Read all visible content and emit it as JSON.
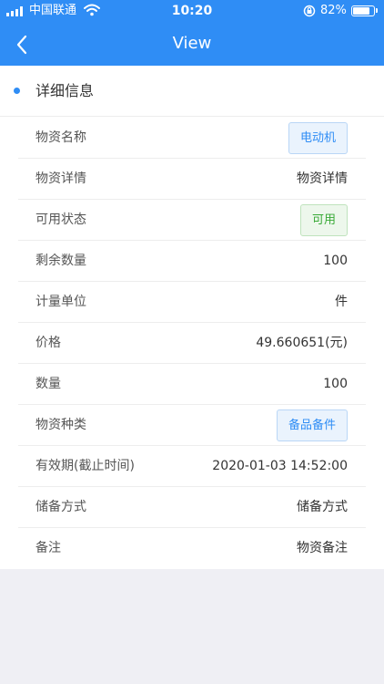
{
  "status_bar": {
    "carrier": "中国联通",
    "time": "10:20",
    "battery_text": "82%",
    "battery_level": 0.82
  },
  "nav": {
    "title": "View"
  },
  "section": {
    "title": "详细信息"
  },
  "fields": [
    {
      "label": "物资名称",
      "value": "电动机",
      "style": "tag-blue"
    },
    {
      "label": "物资详情",
      "value": "物资详情",
      "style": "text"
    },
    {
      "label": "可用状态",
      "value": "可用",
      "style": "tag-green"
    },
    {
      "label": "剩余数量",
      "value": "100",
      "style": "text"
    },
    {
      "label": "计量单位",
      "value": "件",
      "style": "text"
    },
    {
      "label": "价格",
      "value": "49.660651(元)",
      "style": "text"
    },
    {
      "label": "数量",
      "value": "100",
      "style": "text"
    },
    {
      "label": "物资种类",
      "value": "备品备件",
      "style": "tag-blue"
    },
    {
      "label": "有效期(截止时间)",
      "value": "2020-01-03 14:52:00",
      "style": "text"
    },
    {
      "label": "储备方式",
      "value": "储备方式",
      "style": "text"
    },
    {
      "label": "备注",
      "value": "物资备注",
      "style": "text"
    }
  ],
  "colors": {
    "primary": "#2f8df5",
    "success": "#38a936",
    "background": "#efeff4"
  },
  "icons": {
    "back": "chevron-left-icon",
    "wifi": "wifi-icon",
    "lock": "rotation-lock-icon",
    "battery": "battery-icon",
    "signal": "signal-icon"
  }
}
